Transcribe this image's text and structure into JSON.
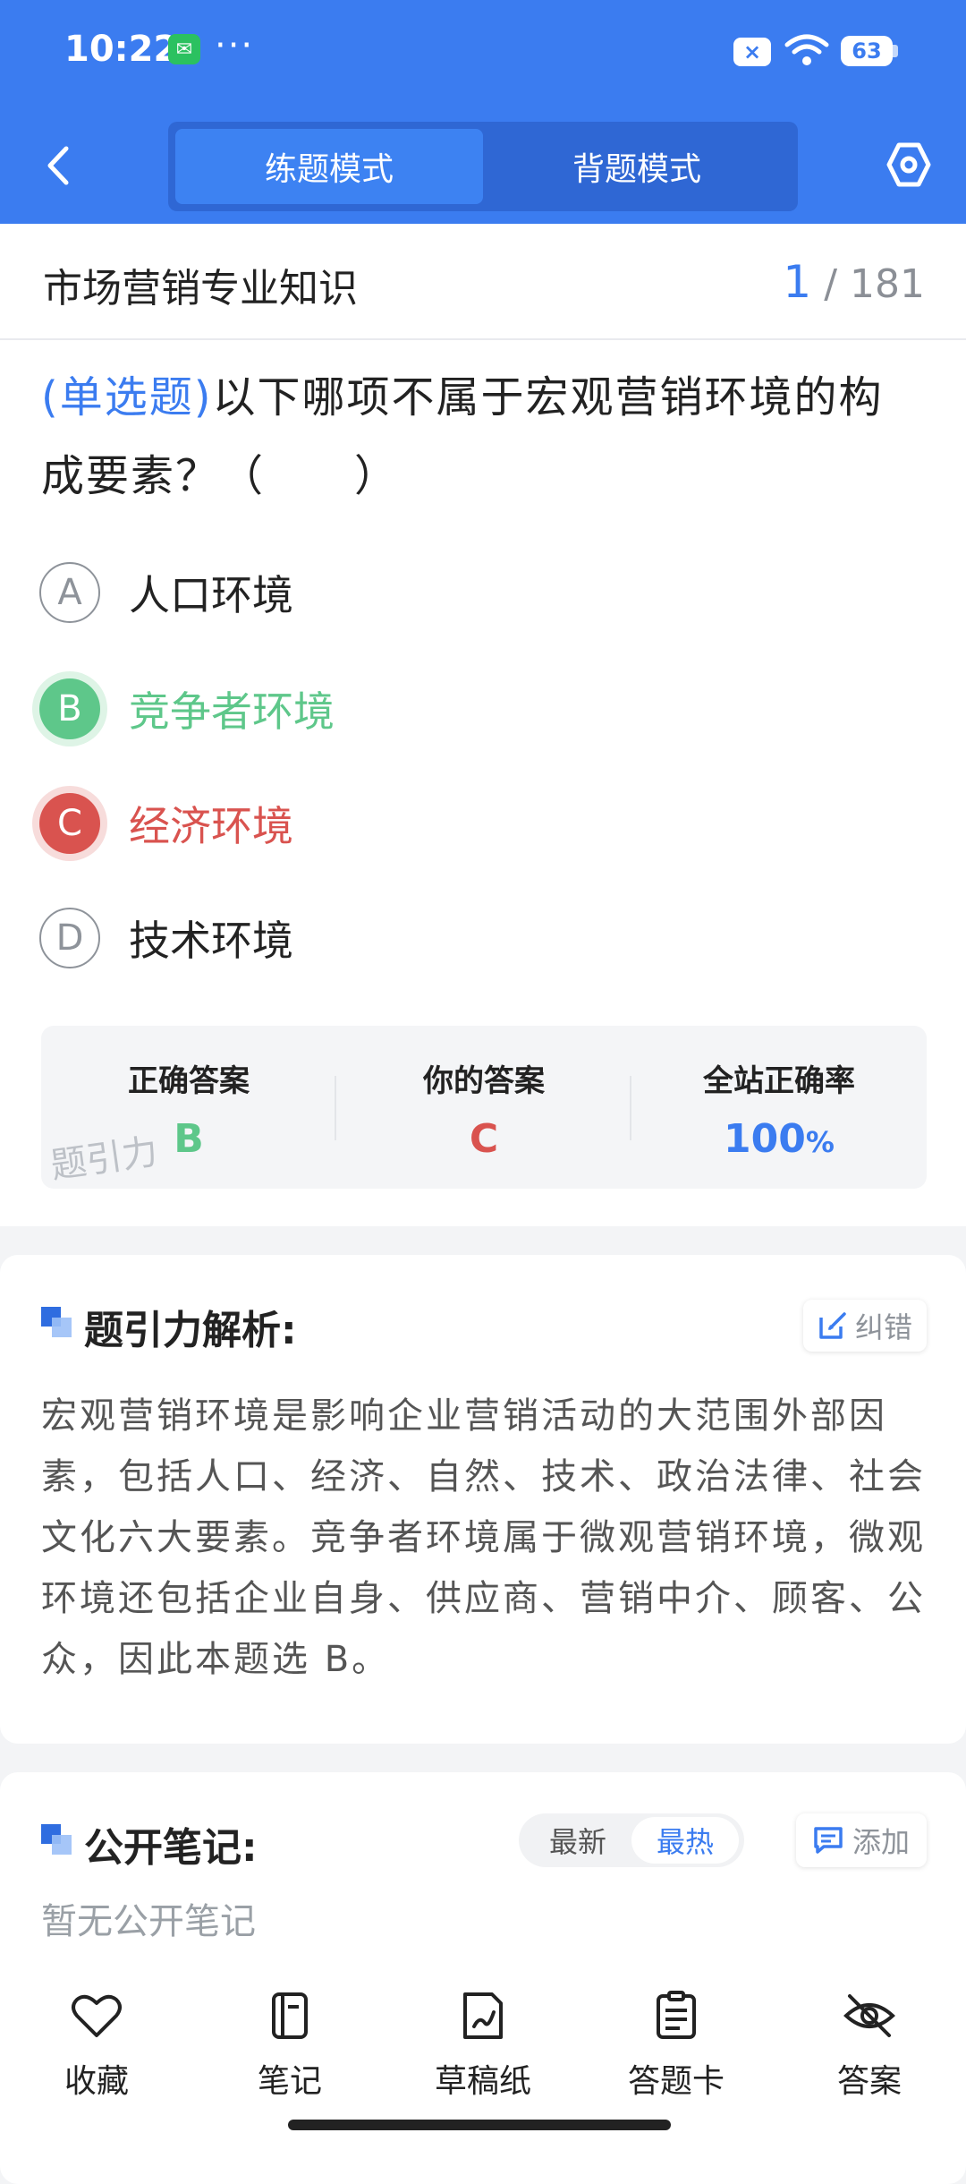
{
  "status_bar": {
    "time": "10:22",
    "dots": "···",
    "battery": "63"
  },
  "header": {
    "tabs": [
      {
        "label": "练题模式",
        "active": true
      },
      {
        "label": "背题模式",
        "active": false
      }
    ]
  },
  "question": {
    "subject": "市场营销专业知识",
    "progress_current": "1",
    "progress_total": "/ 181",
    "type_label": "(单选题)",
    "text": "以下哪项不属于宏观营销环境的构成要素？（　　）",
    "options": [
      {
        "letter": "A",
        "text": "人口环境",
        "state": "normal"
      },
      {
        "letter": "B",
        "text": "竞争者环境",
        "state": "correct"
      },
      {
        "letter": "C",
        "text": "经济环境",
        "state": "wrong"
      },
      {
        "letter": "D",
        "text": "技术环境",
        "state": "normal"
      }
    ]
  },
  "answer_summary": {
    "correct_label": "正确答案",
    "correct_value": "B",
    "yours_label": "你的答案",
    "yours_value": "C",
    "rate_label": "全站正确率",
    "rate_value": "100",
    "rate_unit": "%",
    "watermark": "题引力"
  },
  "analysis": {
    "title": "题引力解析:",
    "correction_label": "纠错",
    "text": "宏观营销环境是影响企业营销活动的大范围外部因素，包括人口、经济、自然、技术、政治法律、社会文化六大要素。竞争者环境属于微观营销环境，微观环境还包括企业自身、供应商、营销中介、顾客、公众，因此本题选 B。"
  },
  "notes": {
    "title": "公开笔记:",
    "sort_options": [
      "最新",
      "最热"
    ],
    "active_sort": "最热",
    "add_label": "添加",
    "empty_text": "暂无公开笔记"
  },
  "bottom_nav": [
    {
      "label": "收藏",
      "icon": "heart-icon"
    },
    {
      "label": "笔记",
      "icon": "notebook-icon"
    },
    {
      "label": "草稿纸",
      "icon": "draft-paper-icon"
    },
    {
      "label": "答题卡",
      "icon": "answer-sheet-icon"
    },
    {
      "label": "答案",
      "icon": "eye-off-icon"
    }
  ],
  "colors": {
    "primary": "#3b7cf0",
    "correct": "#5ec78a",
    "wrong": "#d9534f"
  }
}
